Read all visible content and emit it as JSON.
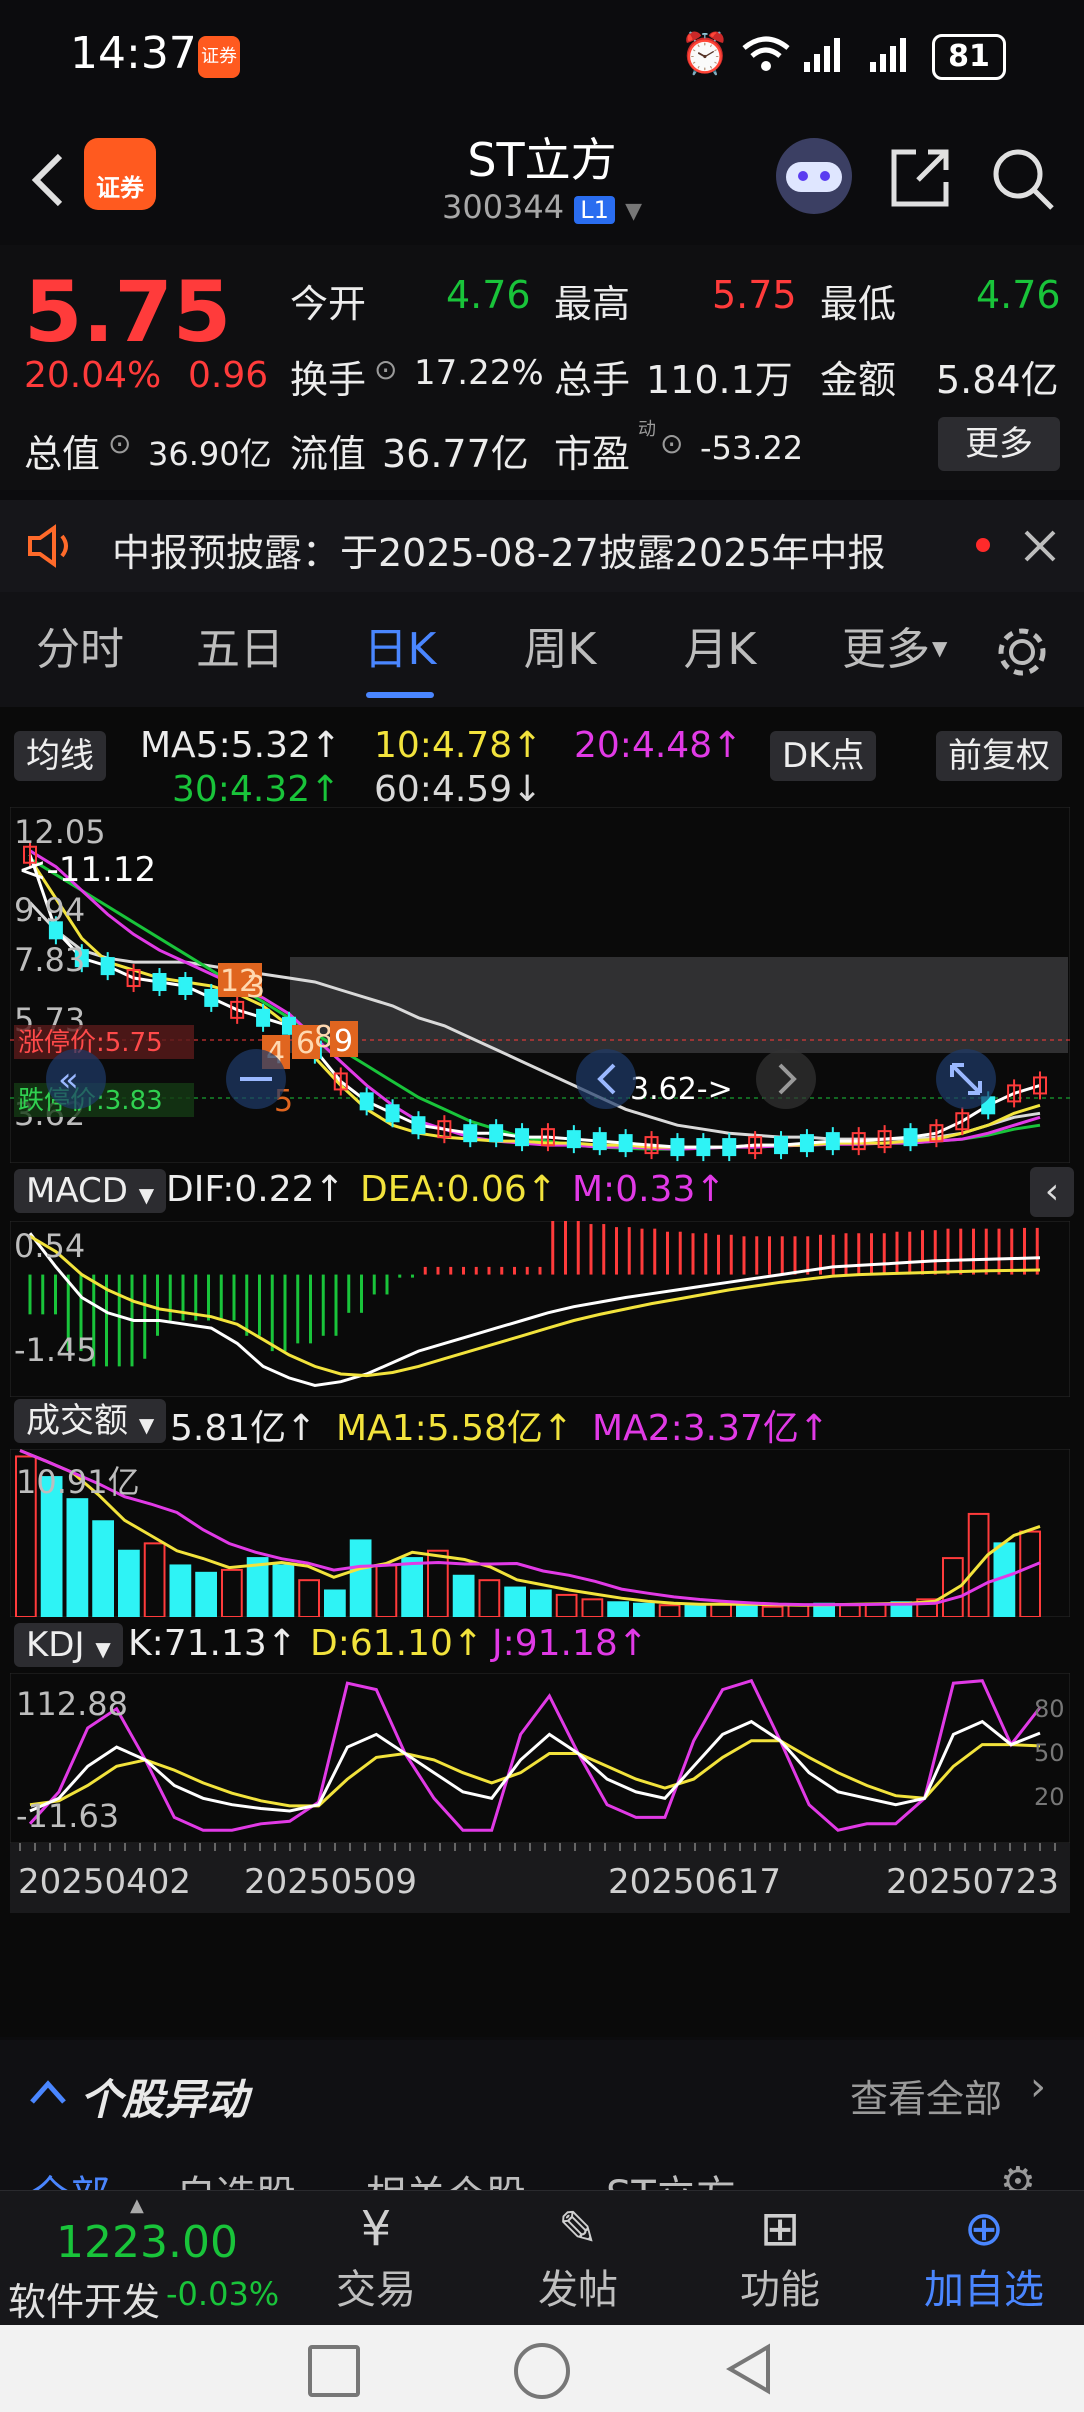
{
  "status": {
    "time": "14:37",
    "app_badge": "证券",
    "battery": "81"
  },
  "header": {
    "app_logo": "证券",
    "title": "ST立方",
    "code": "300344",
    "level_badge": "L1"
  },
  "quote": {
    "price": "5.75",
    "pct": "20.04%",
    "change": "0.96",
    "open_label": "今开",
    "open": "4.76",
    "high_label": "最高",
    "high": "5.75",
    "low_label": "最低",
    "low": "4.76",
    "turnover_label": "换手",
    "turnover": "17.22%",
    "volume_label": "总手",
    "volume": "110.1万",
    "amount_label": "金额",
    "amount": "5.84亿",
    "mktcap_label": "总值",
    "mktcap": "36.90亿",
    "float_label": "流值",
    "float": "36.77亿",
    "pe_label": "市盈",
    "pe_sup": "动",
    "pe": "-53.22",
    "more_button": "更多"
  },
  "notice": {
    "text": "中报预披露：于2025-08-27披露2025年中报"
  },
  "tabs": [
    "分时",
    "五日",
    "日K",
    "周K",
    "月K",
    "更多"
  ],
  "chart_controls": {
    "ma_button": "均线",
    "dk_button": "DK点",
    "adjust_button": "前复权"
  },
  "chart_data": [
    {
      "type": "candlestick",
      "title": "",
      "indicators": [
        {
          "name": "MA5",
          "text": "MA5:5.32↑",
          "color": "#ffffff"
        },
        {
          "name": "MA10",
          "text": "10:4.78↑",
          "color": "#f2e33c"
        },
        {
          "name": "MA20",
          "text": "20:4.48↑",
          "color": "#e13ae6"
        },
        {
          "name": "MA30",
          "text": "30:4.32↑",
          "color": "#19c43a"
        },
        {
          "name": "MA60",
          "text": "60:4.59↓",
          "color": "#d9d9d9"
        }
      ],
      "y_ticks": [
        "12.05",
        "9.94",
        "7.83",
        "5.73",
        "3.62"
      ],
      "annotations": [
        "<-11.12",
        "3.62->",
        "涨停价:5.75",
        "跌停价:3.83"
      ],
      "markers": [
        "12",
        "3",
        "4",
        "6",
        "8",
        "9",
        "5"
      ],
      "limit_up": 5.75,
      "limit_down": 3.83,
      "ma_white": [
        11.1,
        9.2,
        8.5,
        8.3,
        8.0,
        7.9,
        7.8,
        7.5,
        7.2,
        7.0,
        6.8,
        6.2,
        5.4,
        4.9,
        4.6,
        4.3,
        4.2,
        4.1,
        4.1,
        4.0,
        4.0,
        3.95,
        3.9,
        3.85,
        3.8,
        3.75,
        3.75,
        3.75,
        3.8,
        3.8,
        3.85,
        3.9,
        3.9,
        3.95,
        4.0,
        4.1,
        4.4,
        4.8,
        5.1,
        5.3
      ],
      "ma_yellow": [
        11.0,
        10.0,
        9.0,
        8.4,
        8.2,
        8.0,
        7.9,
        7.8,
        7.6,
        7.3,
        6.8,
        6.0,
        5.3,
        4.7,
        4.3,
        4.1,
        4.0,
        3.95,
        3.9,
        3.9,
        3.85,
        3.85,
        3.8,
        3.8,
        3.75,
        3.75,
        3.75,
        3.75,
        3.8,
        3.8,
        3.8,
        3.85,
        3.85,
        3.85,
        3.9,
        3.95,
        4.1,
        4.3,
        4.6,
        4.8
      ],
      "ma_magenta": [
        11.2,
        10.8,
        10.2,
        9.6,
        9.1,
        8.7,
        8.4,
        8.1,
        7.8,
        7.5,
        7.1,
        6.5,
        5.9,
        5.3,
        4.8,
        4.4,
        4.2,
        4.0,
        3.9,
        3.85,
        3.8,
        3.8,
        3.75,
        3.75,
        3.72,
        3.7,
        3.72,
        3.75,
        3.75,
        3.78,
        3.8,
        3.82,
        3.82,
        3.85,
        3.85,
        3.9,
        3.95,
        4.1,
        4.3,
        4.5
      ],
      "ma_green": [
        11.0,
        10.6,
        10.2,
        9.8,
        9.4,
        9.0,
        8.6,
        8.2,
        7.8,
        7.4,
        7.0,
        6.6,
        6.2,
        5.8,
        5.4,
        5.0,
        4.7,
        4.4,
        4.2,
        4.0,
        3.9,
        3.8,
        3.75,
        3.72,
        3.7,
        3.7,
        3.72,
        3.75,
        3.75,
        3.78,
        3.8,
        3.82,
        3.85,
        3.85,
        3.85,
        3.9,
        3.95,
        4.05,
        4.2,
        4.3
      ],
      "ma_gray": [
        9.9,
        9.2,
        8.7,
        8.5,
        8.4,
        8.4,
        8.4,
        8.3,
        8.2,
        8.1,
        8.0,
        7.9,
        7.7,
        7.5,
        7.3,
        7.0,
        6.8,
        6.5,
        6.2,
        5.9,
        5.6,
        5.3,
        5.0,
        4.7,
        4.5,
        4.3,
        4.2,
        4.1,
        4.05,
        4.0,
        4.0,
        3.95,
        3.95,
        3.95,
        3.95,
        4.0,
        4.1,
        4.3,
        4.5,
        4.6
      ]
    },
    {
      "type": "bar",
      "title": "MACD",
      "indicators": [
        {
          "name": "DIF",
          "text": "DIF:0.22↑",
          "color": "#ffffff"
        },
        {
          "name": "DEA",
          "text": "DEA:0.06↑",
          "color": "#f2e33c"
        },
        {
          "name": "M",
          "text": "M:0.33↑",
          "color": "#e13ae6"
        }
      ],
      "y_ticks": [
        "0.54",
        "-1.45"
      ],
      "dif": [
        0.54,
        0.1,
        -0.3,
        -0.5,
        -0.6,
        -0.6,
        -0.65,
        -0.7,
        -0.9,
        -1.2,
        -1.35,
        -1.45,
        -1.4,
        -1.3,
        -1.15,
        -1.0,
        -0.9,
        -0.8,
        -0.7,
        -0.6,
        -0.5,
        -0.42,
        -0.36,
        -0.3,
        -0.25,
        -0.2,
        -0.15,
        -0.1,
        -0.05,
        0.0,
        0.05,
        0.1,
        0.12,
        0.14,
        0.16,
        0.18,
        0.19,
        0.2,
        0.21,
        0.22
      ],
      "dea": [
        0.5,
        0.3,
        0.0,
        -0.2,
        -0.35,
        -0.45,
        -0.5,
        -0.55,
        -0.65,
        -0.85,
        -1.05,
        -1.2,
        -1.3,
        -1.32,
        -1.28,
        -1.2,
        -1.1,
        -1.0,
        -0.9,
        -0.8,
        -0.7,
        -0.6,
        -0.52,
        -0.45,
        -0.38,
        -0.32,
        -0.26,
        -0.2,
        -0.15,
        -0.1,
        -0.06,
        -0.02,
        0.0,
        0.01,
        0.02,
        0.03,
        0.04,
        0.05,
        0.055,
        0.06
      ]
    },
    {
      "type": "bar",
      "title": "成交额",
      "indicators": [
        {
          "name": "VOL",
          "text": "5.81亿↑",
          "color": "#ffffff"
        },
        {
          "name": "MA1",
          "text": "MA1:5.58亿↑",
          "color": "#f2e33c"
        },
        {
          "name": "MA2",
          "text": "MA2:3.37亿↑",
          "color": "#e13ae6"
        }
      ],
      "y_ticks": [
        "10.91亿"
      ],
      "values": [
        10.9,
        9.5,
        8.0,
        6.5,
        4.5,
        5.0,
        3.5,
        3.0,
        3.2,
        4.0,
        3.5,
        2.5,
        1.8,
        5.2,
        3.5,
        4.0,
        4.5,
        2.8,
        2.5,
        2.0,
        1.8,
        1.5,
        1.2,
        1.0,
        0.9,
        0.8,
        0.8,
        0.9,
        0.8,
        0.7,
        0.8,
        0.9,
        0.8,
        0.9,
        1.0,
        1.2,
        4.0,
        7.0,
        5.0,
        5.8
      ],
      "up": [
        true,
        false,
        false,
        false,
        false,
        true,
        false,
        false,
        true,
        false,
        false,
        true,
        false,
        false,
        true,
        false,
        true,
        false,
        true,
        false,
        false,
        true,
        true,
        false,
        false,
        true,
        false,
        true,
        false,
        true,
        true,
        false,
        true,
        true,
        false,
        true,
        true,
        true,
        false,
        true
      ]
    },
    {
      "type": "line",
      "title": "KDJ",
      "indicators": [
        {
          "name": "K",
          "text": "K:71.13↑",
          "color": "#ffffff"
        },
        {
          "name": "D",
          "text": "D:61.10↑",
          "color": "#f2e33c"
        },
        {
          "name": "J",
          "text": "J:91.18↑",
          "color": "#e13ae6"
        }
      ],
      "y_ticks": [
        "112.88",
        "-11.63"
      ],
      "right_ticks": [
        "80",
        "50",
        "20"
      ],
      "x_ticks": [
        "20250402",
        "20250509",
        "20250617",
        "20250723"
      ],
      "k": [
        10,
        20,
        45,
        60,
        50,
        30,
        20,
        15,
        12,
        10,
        15,
        60,
        70,
        55,
        40,
        25,
        20,
        50,
        70,
        55,
        35,
        25,
        20,
        45,
        70,
        80,
        65,
        40,
        25,
        20,
        15,
        20,
        70,
        80,
        62,
        71
      ],
      "d": [
        15,
        18,
        30,
        45,
        50,
        42,
        32,
        24,
        18,
        14,
        14,
        35,
        52,
        55,
        50,
        40,
        32,
        40,
        55,
        55,
        45,
        35,
        28,
        35,
        52,
        65,
        65,
        52,
        40,
        30,
        22,
        20,
        45,
        62,
        62,
        61
      ],
      "j": [
        0,
        25,
        75,
        90,
        50,
        5,
        -5,
        -5,
        0,
        2,
        17,
        110,
        105,
        55,
        20,
        -5,
        -5,
        70,
        100,
        55,
        15,
        5,
        5,
        65,
        105,
        112,
        65,
        15,
        -5,
        0,
        0,
        20,
        110,
        112,
        62,
        91
      ]
    }
  ],
  "section": {
    "title": "个股异动",
    "link": "查看全部"
  },
  "subtabs": [
    "全部",
    "自选股",
    "相关个股",
    "ST立方"
  ],
  "bottom": {
    "index_value": "1223.00",
    "index_name": "软件开发",
    "index_pct": "-0.03%",
    "trade": "交易",
    "post": "发帖",
    "function": "功能",
    "add": "加自选"
  }
}
